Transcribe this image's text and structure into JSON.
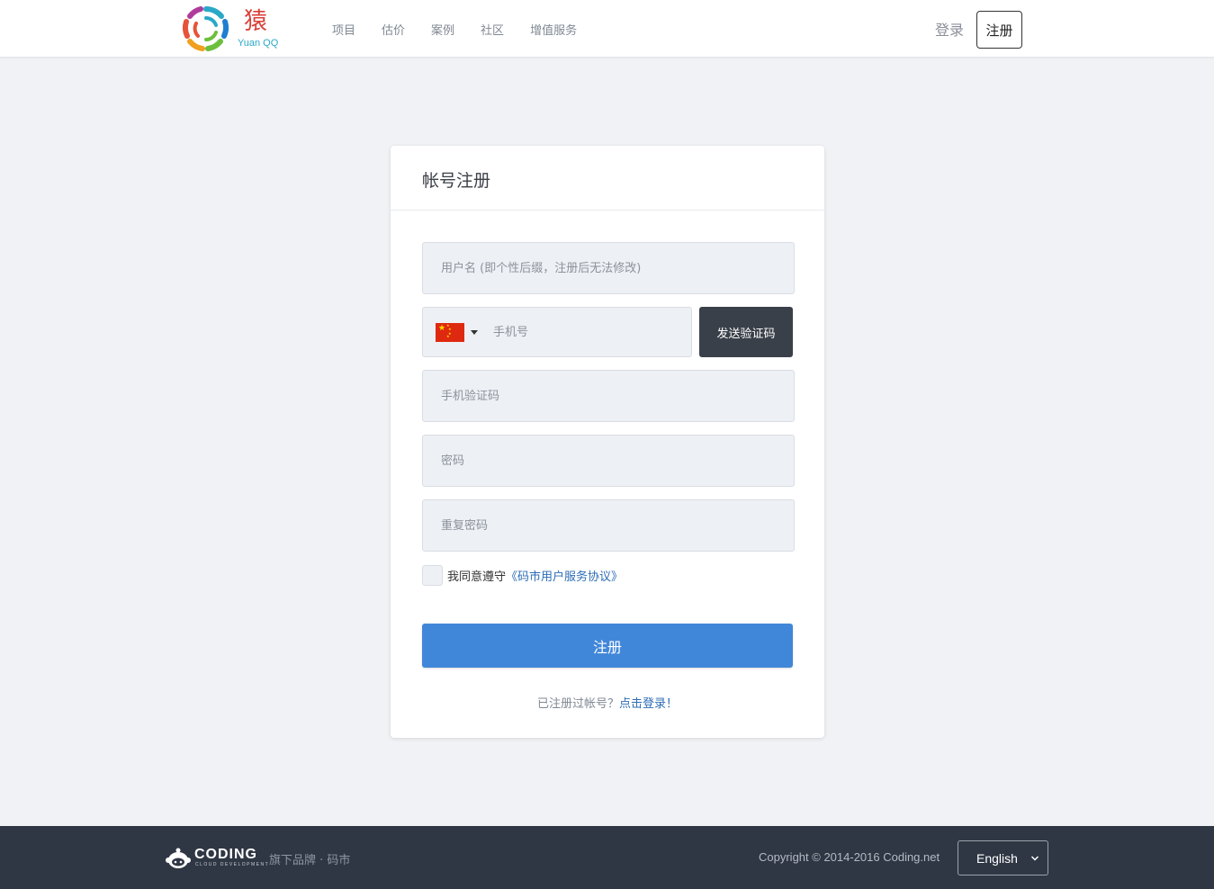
{
  "header": {
    "logo": {
      "glyph": "猿",
      "subtitle": "Yuan QQ"
    },
    "nav": [
      "项目",
      "估价",
      "案例",
      "社区",
      "增值服务"
    ],
    "login_label": "登录",
    "register_label": "注册"
  },
  "form": {
    "title": "帐号注册",
    "username_placeholder": "用户名 (即个性后缀，注册后无法修改)",
    "phone_country": "CN",
    "phone_placeholder": "手机号",
    "send_code_label": "发送验证码",
    "sms_code_placeholder": "手机验证码",
    "password_placeholder": "密码",
    "repeat_password_placeholder": "重复密码",
    "agree_text": "我同意遵守",
    "agree_link": "《码市用户服务协议》",
    "agree_checked": false,
    "submit_label": "注册",
    "already_text": "已注册过帐号？",
    "login_link": "点击登录！"
  },
  "footer": {
    "coding_word": "CODING",
    "coding_tagline": "CLOUD DEVELOPMENT",
    "brand_text": "旗下品牌 · 码市",
    "copyright": "Copyright © 2014-2016  Coding.net",
    "language": "English"
  },
  "colors": {
    "primary": "#4187d9",
    "dark_button": "#3a4049",
    "footer_bg": "#2f3744",
    "page_bg": "#f0f2f5",
    "link": "#2d6cb5"
  }
}
